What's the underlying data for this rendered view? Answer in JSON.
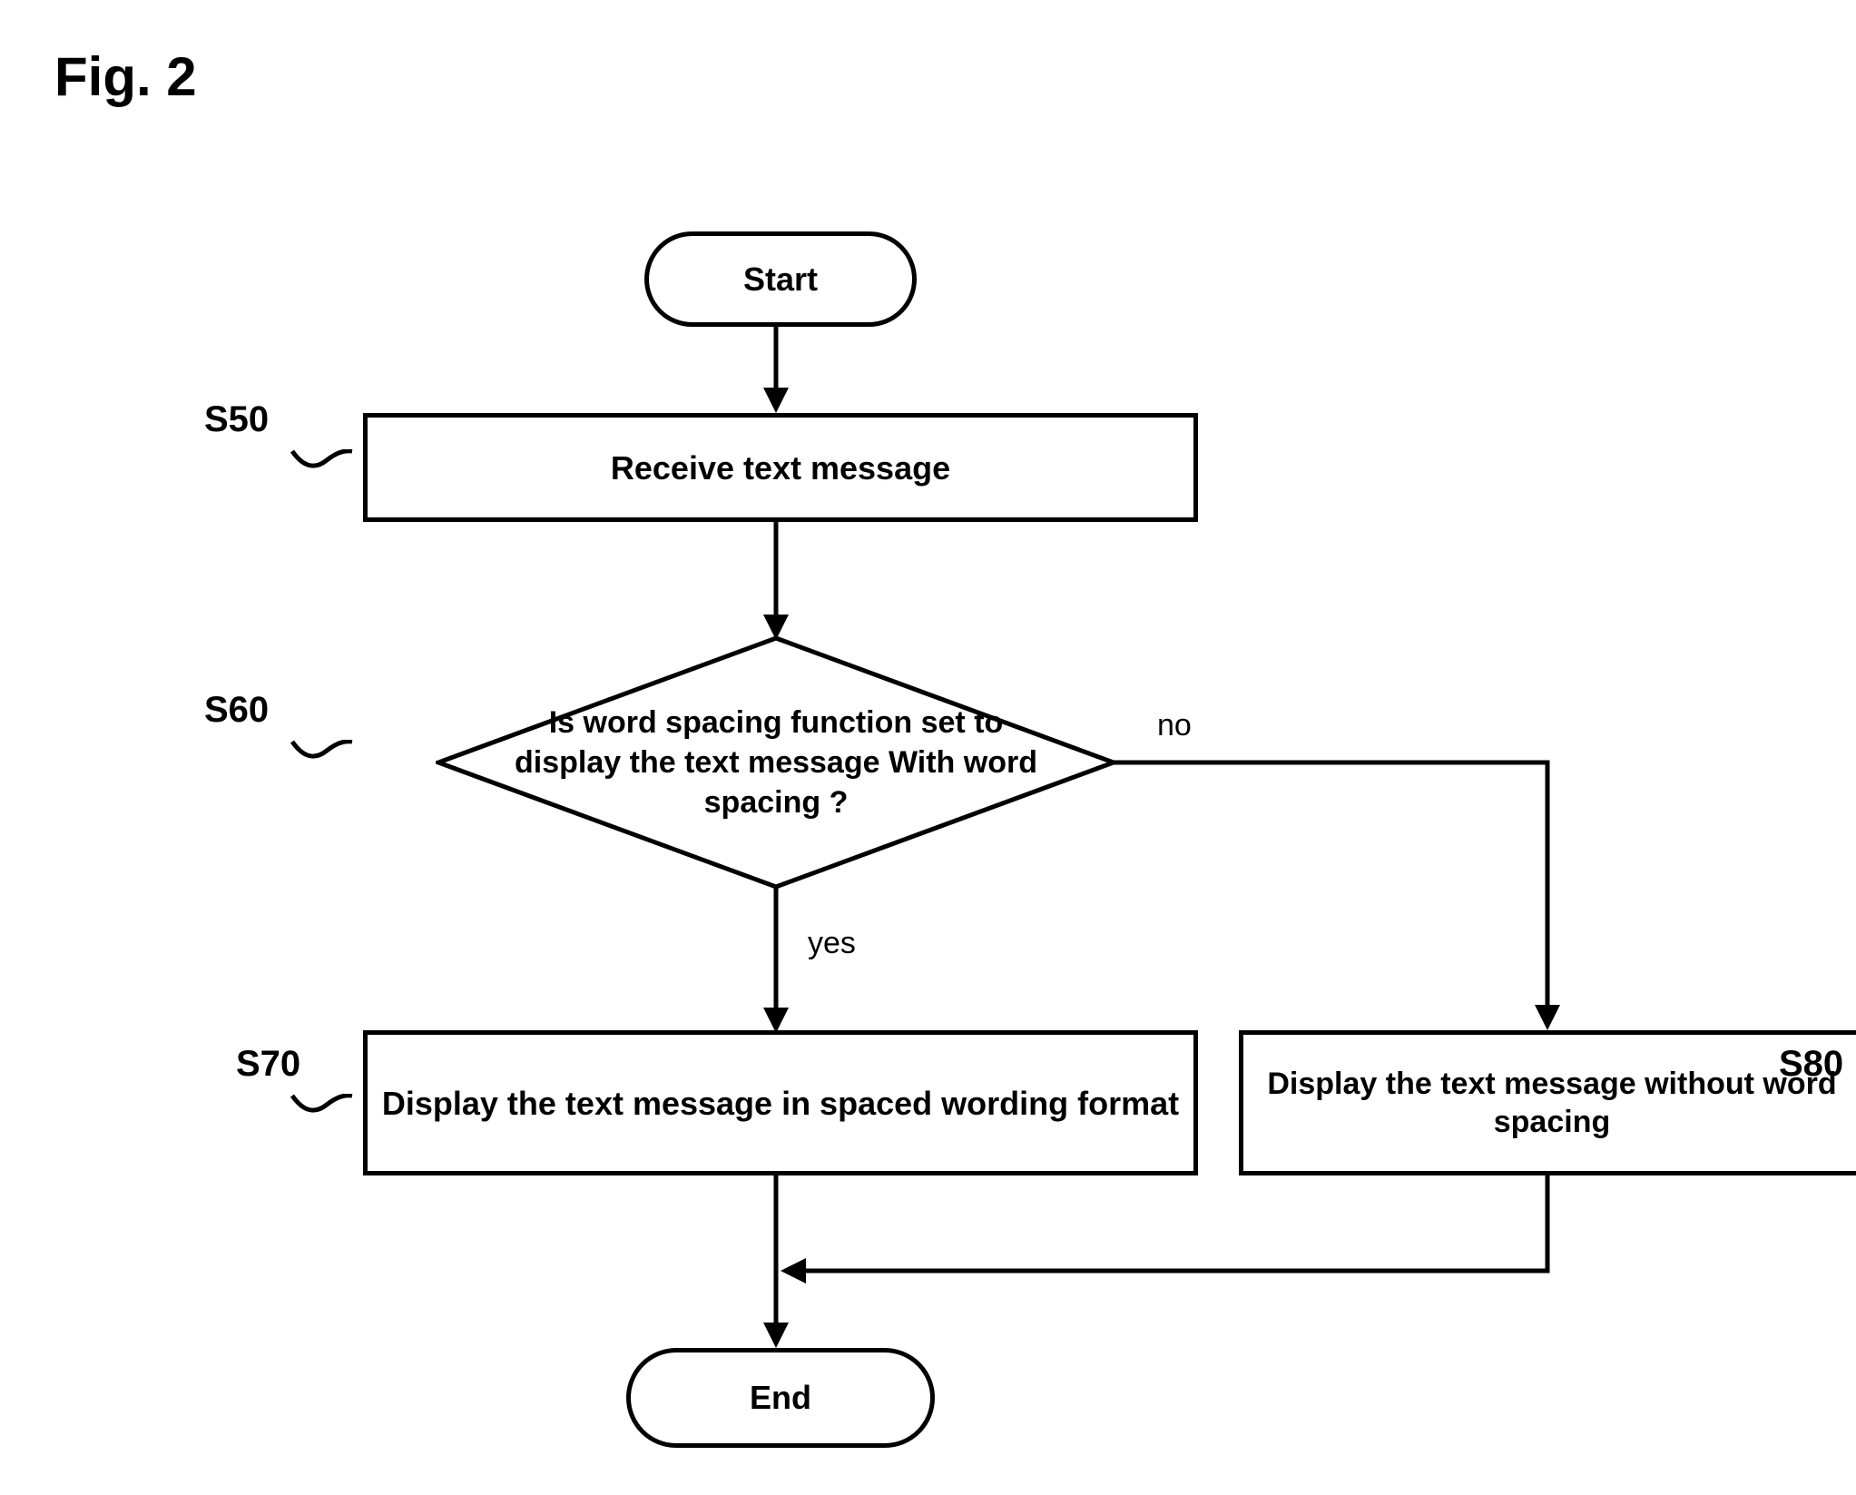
{
  "figure_title": "Fig. 2",
  "nodes": {
    "start": "Start",
    "s50": "Receive text message",
    "s60": "Is word spacing function set to display the text message With word spacing ?",
    "s70": "Display the text message in spaced wording format",
    "s80": "Display the text message without word spacing",
    "end": "End"
  },
  "step_labels": {
    "s50": "S50",
    "s60": "S60",
    "s70": "S70",
    "s80": "S80"
  },
  "edge_labels": {
    "yes": "yes",
    "no": "no"
  },
  "chart_data": {
    "type": "flowchart",
    "nodes": [
      {
        "id": "start",
        "kind": "terminator",
        "label": "Start"
      },
      {
        "id": "s50",
        "kind": "process",
        "step": "S50",
        "label": "Receive text message"
      },
      {
        "id": "s60",
        "kind": "decision",
        "step": "S60",
        "label": "Is word spacing function set to display the text message With word spacing ?"
      },
      {
        "id": "s70",
        "kind": "process",
        "step": "S70",
        "label": "Display the text message in spaced wording format"
      },
      {
        "id": "s80",
        "kind": "process",
        "step": "S80",
        "label": "Display the text message without word spacing"
      },
      {
        "id": "end",
        "kind": "terminator",
        "label": "End"
      }
    ],
    "edges": [
      {
        "from": "start",
        "to": "s50"
      },
      {
        "from": "s50",
        "to": "s60"
      },
      {
        "from": "s60",
        "to": "s70",
        "label": "yes"
      },
      {
        "from": "s60",
        "to": "s80",
        "label": "no"
      },
      {
        "from": "s70",
        "to": "end"
      },
      {
        "from": "s80",
        "to": "end"
      }
    ]
  }
}
